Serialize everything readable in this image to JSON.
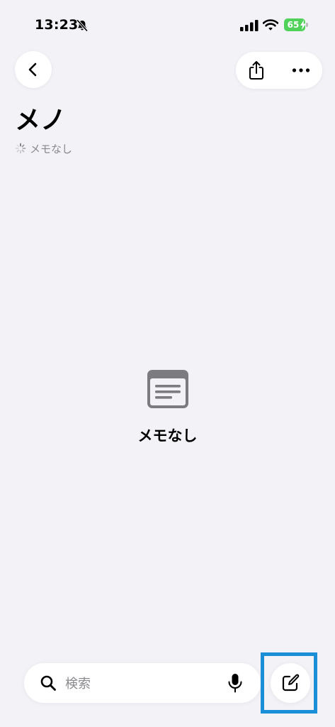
{
  "status_bar": {
    "time": "13:23",
    "battery": "65",
    "icons": [
      "bell-slash-icon",
      "signal-icon",
      "wifi-icon",
      "battery-charging-icon"
    ]
  },
  "nav": {
    "back_icon": "chevron-left-icon",
    "share_icon": "share-icon",
    "more_icon": "ellipsis-icon"
  },
  "header": {
    "title": "メノ",
    "subtitle": "メモなし",
    "subtitle_icon": "spinner-icon"
  },
  "empty_state": {
    "icon": "note-icon",
    "label": "メモなし"
  },
  "search": {
    "placeholder": "検索",
    "value": "",
    "left_icon": "search-icon",
    "right_icon": "mic-icon"
  },
  "compose": {
    "icon": "compose-icon",
    "highlight_color": "#1a8fd8"
  },
  "colors": {
    "background": "#f2f2f7",
    "secondary_text": "#8a8a8e",
    "battery": "#4fd15a"
  }
}
